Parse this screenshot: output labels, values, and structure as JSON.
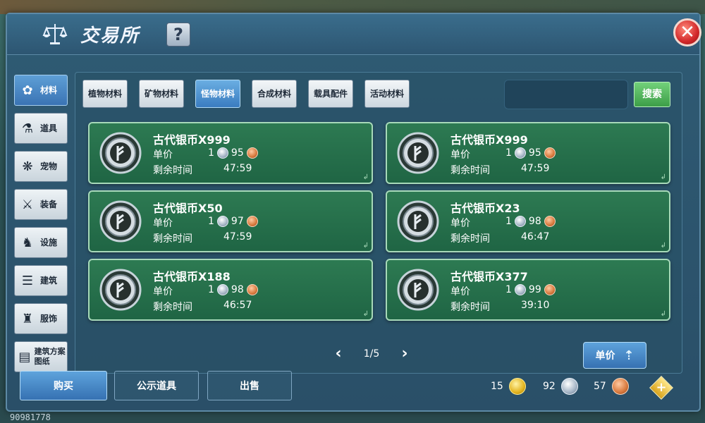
{
  "header": {
    "title": "交易所",
    "help_label": "?",
    "close_label": "✕"
  },
  "sidebar": {
    "items": [
      {
        "label": "材料",
        "icon": "materials-icon",
        "glyph": "✿",
        "active": true
      },
      {
        "label": "道具",
        "icon": "potion-icon",
        "glyph": "⚗",
        "active": false
      },
      {
        "label": "宠物",
        "icon": "paw-icon",
        "glyph": "❋",
        "active": false
      },
      {
        "label": "装备",
        "icon": "sword-icon",
        "glyph": "⚔",
        "active": false
      },
      {
        "label": "设施",
        "icon": "horse-icon",
        "glyph": "♞",
        "active": false
      },
      {
        "label": "建筑",
        "icon": "building-icon",
        "glyph": "☰",
        "active": false
      },
      {
        "label": "服饰",
        "icon": "clothes-icon",
        "glyph": "♜",
        "active": false
      },
      {
        "label": "建筑方案图纸",
        "icon": "blueprint-icon",
        "glyph": "▤",
        "active": false
      }
    ]
  },
  "tabs": [
    {
      "label": "植物材料",
      "active": false
    },
    {
      "label": "矿物材料",
      "active": false
    },
    {
      "label": "怪物材料",
      "active": true
    },
    {
      "label": "合成材料",
      "active": false
    },
    {
      "label": "载具配件",
      "active": false
    },
    {
      "label": "活动材料",
      "active": false
    }
  ],
  "search": {
    "placeholder": "",
    "button_label": "搜索"
  },
  "listings": [
    {
      "name": "古代银币X999",
      "price_label": "单价",
      "silver": "1",
      "copper": "95",
      "time_label": "剩余时间",
      "time": "47:59"
    },
    {
      "name": "古代银币X999",
      "price_label": "单价",
      "silver": "1",
      "copper": "95",
      "time_label": "剩余时间",
      "time": "47:59"
    },
    {
      "name": "古代银币X50",
      "price_label": "单价",
      "silver": "1",
      "copper": "97",
      "time_label": "剩余时间",
      "time": "47:59"
    },
    {
      "name": "古代银币X23",
      "price_label": "单价",
      "silver": "1",
      "copper": "98",
      "time_label": "剩余时间",
      "time": "46:47"
    },
    {
      "name": "古代银币X188",
      "price_label": "单价",
      "silver": "1",
      "copper": "98",
      "time_label": "剩余时间",
      "time": "46:57"
    },
    {
      "name": "古代银币X377",
      "price_label": "单价",
      "silver": "1",
      "copper": "99",
      "time_label": "剩余时间",
      "time": "39:10"
    }
  ],
  "pagination": {
    "text": "1/5",
    "prev": "‹",
    "next": "›"
  },
  "sort": {
    "label": "单价",
    "arrow": "⇡"
  },
  "actions": {
    "buy": "购买",
    "public": "公示道具",
    "sell": "出售"
  },
  "wallet": {
    "gold": "15",
    "silver": "92",
    "copper": "57",
    "add_label": "+"
  },
  "player_id": "90981778"
}
